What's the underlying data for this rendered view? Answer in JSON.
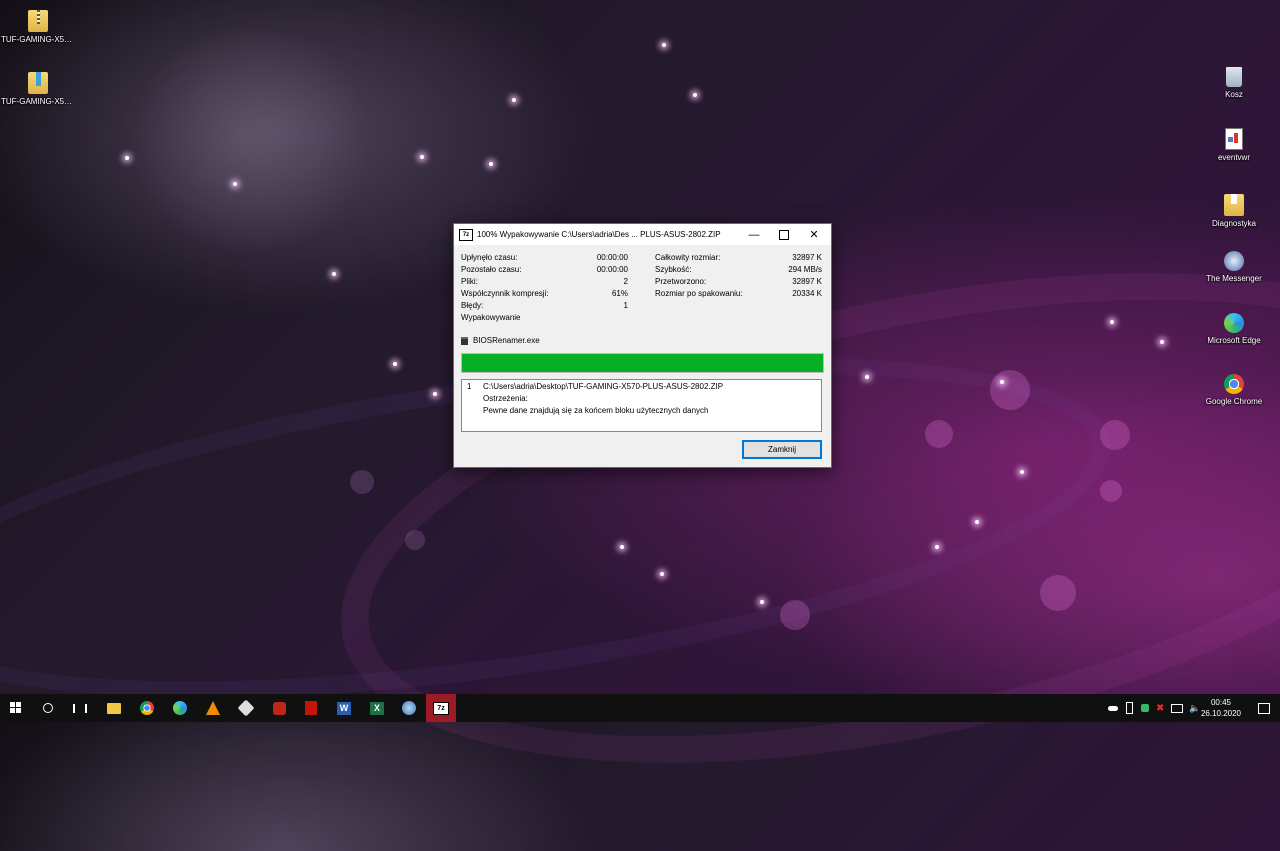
{
  "desktop": {
    "left_icons": [
      {
        "label": "TUF-GAMING-X57...",
        "icon": "zip-folder-icon"
      },
      {
        "label": "TUF-GAMING-X57...",
        "icon": "folder-icon"
      }
    ],
    "right_icons": [
      {
        "label": "Kosz",
        "icon": "recycle-bin-icon"
      },
      {
        "label": "eventvwr",
        "icon": "eventvwr-icon"
      },
      {
        "label": "Diagnostyka",
        "icon": "folder-icon"
      },
      {
        "label": "The Messenger",
        "icon": "messenger-game-icon"
      },
      {
        "label": "Microsoft Edge",
        "icon": "edge-icon"
      },
      {
        "label": "Google Chrome",
        "icon": "chrome-icon"
      }
    ]
  },
  "dialog": {
    "app_icon_text": "7z",
    "title": "100% Wypakowywanie C:\\Users\\adria\\Des ... PLUS-ASUS-2802.ZIP",
    "stats_left": [
      {
        "label": "Upłynęło czasu:",
        "value": "00:00:00"
      },
      {
        "label": "Pozostało czasu:",
        "value": "00:00:00"
      },
      {
        "label": "Pliki:",
        "value": "2"
      },
      {
        "label": "Współczynnik kompresji:",
        "value": "61%"
      },
      {
        "label": "Błędy:",
        "value": "1"
      }
    ],
    "stats_right": [
      {
        "label": "Całkowity rozmiar:",
        "value": "32897 K"
      },
      {
        "label": "Szybkość:",
        "value": "294 MB/s"
      },
      {
        "label": "Przetworzono:",
        "value": "32897 K"
      },
      {
        "label": "Rozmiar po spakowaniu:",
        "value": "20334 K"
      }
    ],
    "operation": "Wypakowywanie",
    "current_file": "BIOSRenamer.exe",
    "progress_percent": 100,
    "log": {
      "index": "1",
      "path": "C:\\Users\\adria\\Desktop\\TUF-GAMING-X570-PLUS-ASUS-2802.ZIP",
      "warning_header": "Ostrzeżenia:",
      "warning_text": "Pewne dane znajdują się za końcem bloku użytecznych danych"
    },
    "close_button": "Zamknij"
  },
  "taskbar": {
    "apps": [
      "start-icon",
      "search-icon",
      "task-view-icon",
      "file-explorer-icon",
      "chrome-icon",
      "edge-icon",
      "vlc-icon",
      "inkscape-icon",
      "game-icon",
      "acrobat-icon",
      "word-icon",
      "excel-icon",
      "network-tool-icon",
      "7zip-icon"
    ],
    "time": "00:45",
    "date": "26.10.2020"
  },
  "colors": {
    "progress": "#06b025",
    "accent": "#0078d7"
  }
}
